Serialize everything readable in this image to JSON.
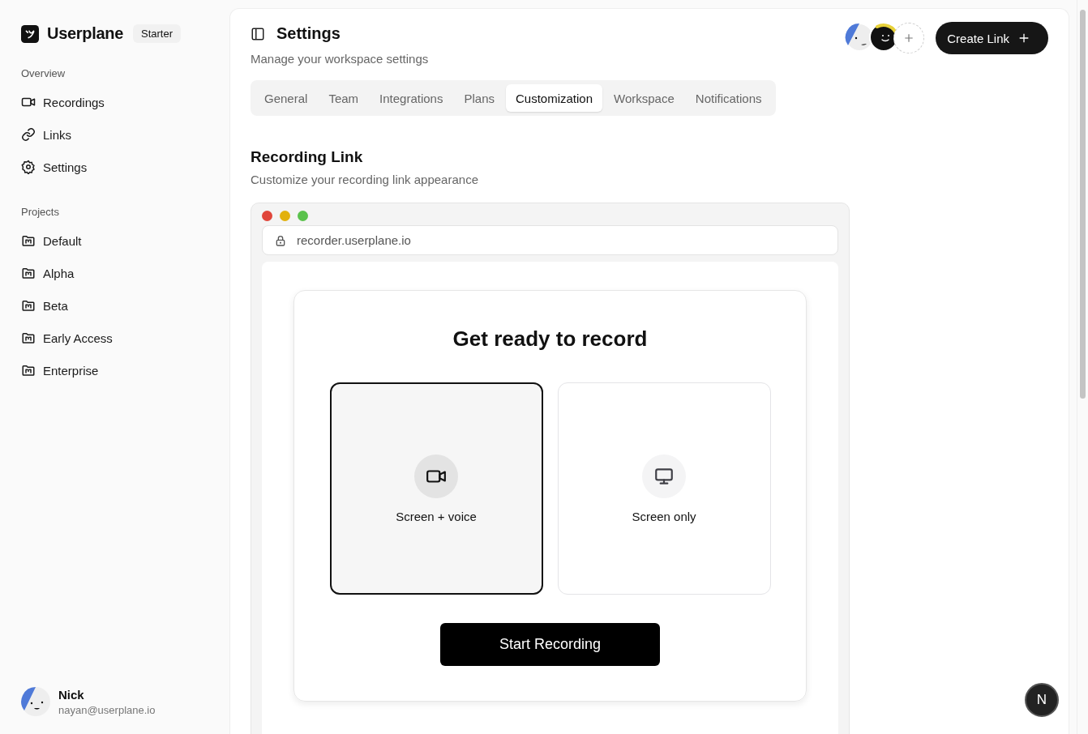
{
  "sidebar": {
    "brand": "Userplane",
    "plan_badge": "Starter",
    "sections": [
      {
        "heading": "Overview",
        "items": [
          {
            "label": "Recordings"
          },
          {
            "label": "Links"
          },
          {
            "label": "Settings"
          }
        ]
      },
      {
        "heading": "Projects",
        "items": [
          {
            "label": "Default"
          },
          {
            "label": "Alpha"
          },
          {
            "label": "Beta"
          },
          {
            "label": "Early Access"
          },
          {
            "label": "Enterprise"
          }
        ]
      }
    ],
    "user": {
      "name": "Nick",
      "email": "nayan@userplane.io"
    }
  },
  "header": {
    "title": "Settings",
    "subtitle": "Manage your workspace settings",
    "create_button": "Create Link"
  },
  "tabs": [
    {
      "label": "General",
      "selected": false
    },
    {
      "label": "Team",
      "selected": false
    },
    {
      "label": "Integrations",
      "selected": false
    },
    {
      "label": "Plans",
      "selected": false
    },
    {
      "label": "Customization",
      "selected": true
    },
    {
      "label": "Workspace",
      "selected": false
    },
    {
      "label": "Notifications",
      "selected": false
    }
  ],
  "section": {
    "title": "Recording Link",
    "description": "Customize your recording link appearance"
  },
  "preview": {
    "url": "recorder.userplane.io",
    "heading": "Get ready to record",
    "options": [
      {
        "label": "Screen + voice",
        "selected": true
      },
      {
        "label": "Screen only",
        "selected": false
      }
    ],
    "start_button": "Start Recording"
  },
  "dev_badge": "N"
}
